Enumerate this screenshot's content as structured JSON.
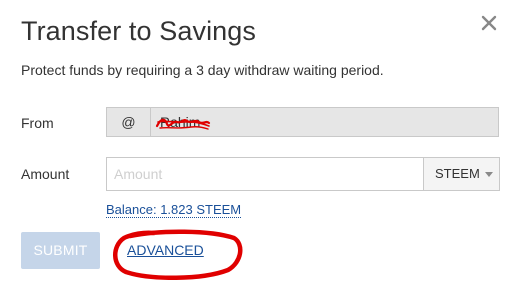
{
  "dialog": {
    "title": "Transfer to Savings",
    "subtitle": "Protect funds by requiring a 3 day withdraw waiting period."
  },
  "form": {
    "from": {
      "label": "From",
      "prefix": "@",
      "value": "Rahim"
    },
    "amount": {
      "label": "Amount",
      "placeholder": "Amount",
      "value": ""
    },
    "asset": {
      "selected": "STEEM"
    },
    "balance": {
      "text": "Balance: 1.823 STEEM"
    }
  },
  "actions": {
    "submit_label": "SUBMIT",
    "advanced_label": "ADVANCED"
  },
  "icons": {
    "close": "close-icon",
    "asset_dropdown": "chevron-down-icon"
  },
  "colors": {
    "link": "#1a5099",
    "submit_disabled": "#c5d5e9",
    "annotation_red": "#e00000",
    "readonly_bg": "#e6e6e6"
  }
}
